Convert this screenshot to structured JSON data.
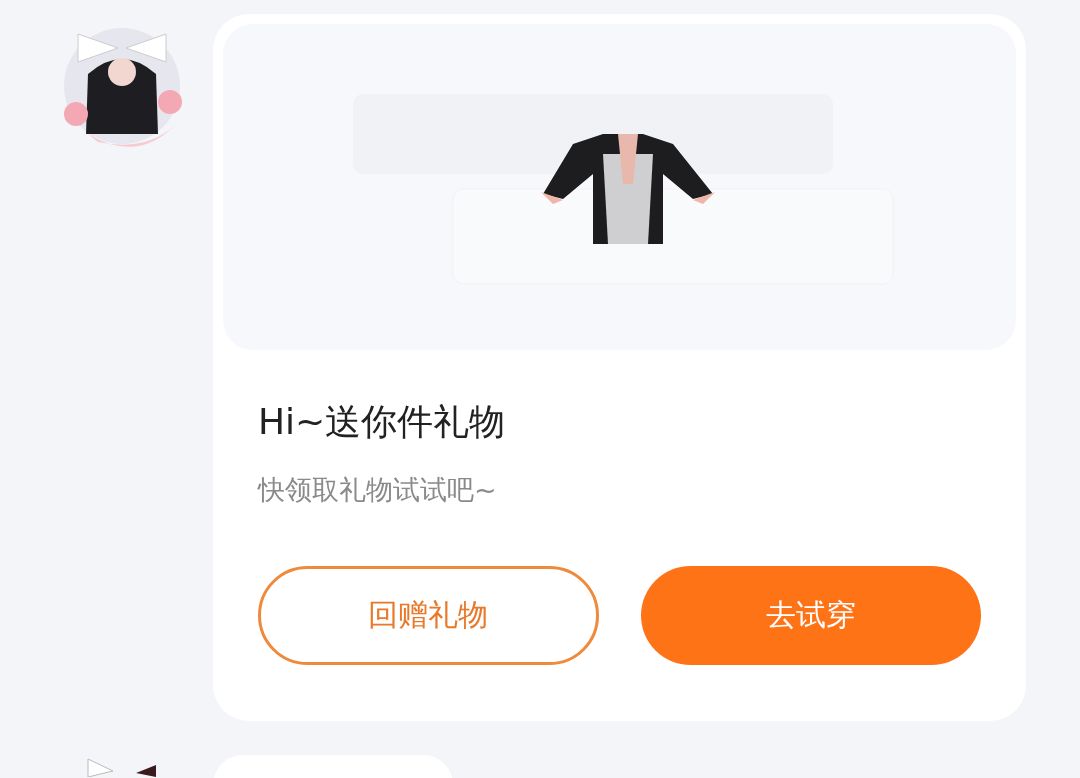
{
  "messages": [
    {
      "kind": "gift",
      "title": "Hi~送你件礼物",
      "subtitle": "快领取礼物试试吧~",
      "buttons": [
        {
          "label": "回赠礼物",
          "kind": "outline"
        },
        {
          "label": "去试穿",
          "kind": "primary"
        }
      ]
    },
    {
      "kind": "bubble"
    }
  ]
}
